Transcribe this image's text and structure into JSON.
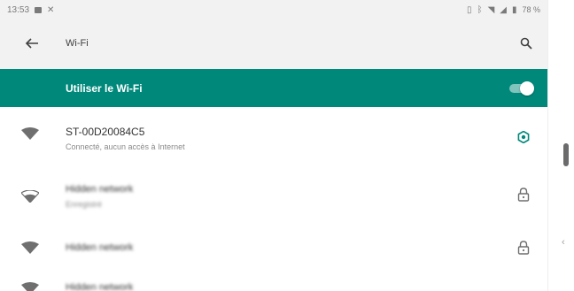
{
  "status_bar": {
    "time": "13:53",
    "right_text": "78 %"
  },
  "toolbar": {
    "title": "Wi-Fi"
  },
  "master_switch": {
    "label": "Utiliser le Wi-Fi",
    "on": true
  },
  "networks": [
    {
      "name": "ST-00D20084C5",
      "status": "Connecté, aucun accès à Internet",
      "trailing": "gear-icon"
    },
    {
      "name": "Hidden network",
      "status": "Enregistré",
      "trailing": "lock-icon"
    },
    {
      "name": "Hidden network",
      "status": "",
      "trailing": "lock-icon"
    },
    {
      "name": "Hidden network",
      "status": "",
      "trailing": ""
    }
  ],
  "colors": {
    "accent": "#00897b",
    "toolbar_bg": "#f2f2f2",
    "text_primary": "#333333",
    "text_secondary": "#8a8a8a"
  }
}
